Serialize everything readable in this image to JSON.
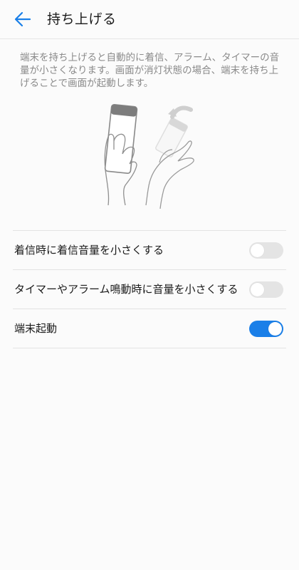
{
  "header": {
    "title": "持ち上げる",
    "back_icon": "arrow-left-icon",
    "accent_color": "#1a7fe8"
  },
  "description": "端末を持ち上げると自動的に着信、アラーム、タイマーの音量が小さくなります。画面が消灯状態の場合、端末を持ち上げることで画面が起動します。",
  "illustration": {
    "icon": "hand-lifting-phone-illustration"
  },
  "settings": [
    {
      "label": "着信時に着信音量を小さくする",
      "enabled": false
    },
    {
      "label": "タイマーやアラーム鳴動時に音量を小さくする",
      "enabled": false
    },
    {
      "label": "端末起動",
      "enabled": true
    }
  ]
}
